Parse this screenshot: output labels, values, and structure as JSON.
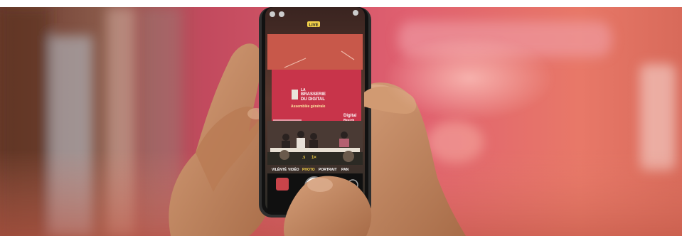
{
  "screen": {
    "brand_line1": "LA",
    "brand_line2": "BRASSERIE",
    "brand_line3": "DU DIGITAL",
    "brand_line4": "Assemblée générale",
    "corner_logo_line1": "Digital",
    "corner_logo_line2": "Breizh",
    "live_badge": "LIVE"
  },
  "camera_modes": [
    "VILÉNTÉ",
    "VIDÉO",
    "PHOTO",
    "PORTRAIT",
    "PAN"
  ],
  "colors": {
    "backdrop": "#d85a63",
    "screen_red": "#c8344a",
    "skin": "#c98e66",
    "phone_frame": "#3a3a3a",
    "mode_active": "#f5d34a"
  }
}
